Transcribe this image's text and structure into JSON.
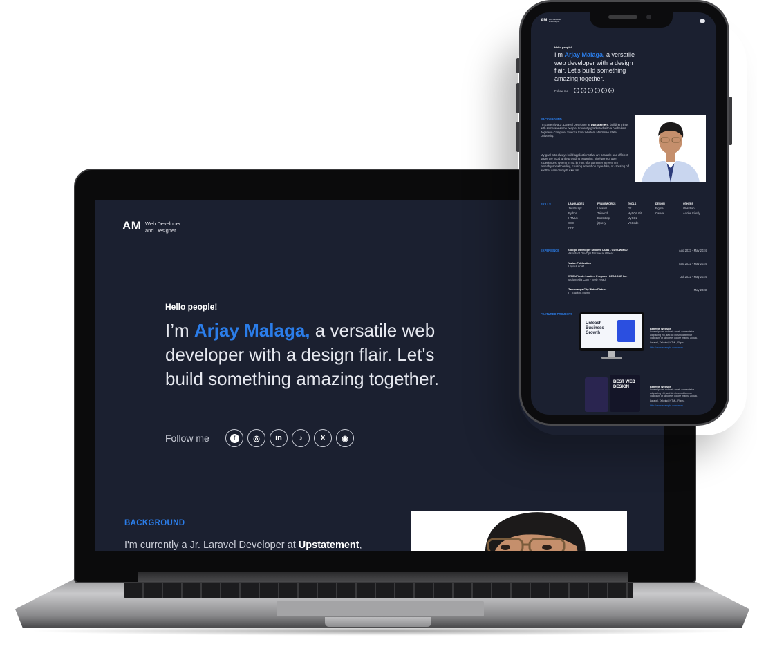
{
  "logo": {
    "initials": "AM",
    "tagline": "Web Developer and Designer"
  },
  "hero": {
    "greeting": "Hello people!",
    "prefix": "I’m ",
    "name": "Arjay Malaga",
    "comma": ",",
    "suffix": " a versatile web developer with a design flair. Let's build something amazing together."
  },
  "social": {
    "label": "Follow me",
    "icons": [
      "facebook-icon",
      "instagram-icon",
      "linkedin-icon",
      "tiktok-icon",
      "x-icon",
      "github-icon"
    ],
    "glyphs": [
      "f",
      "◎",
      "in",
      "♪",
      "X",
      "◉"
    ]
  },
  "background": {
    "heading": "BACKGROUND",
    "intro_prefix": "I'm currently a Jr. Laravel Developer at ",
    "company": "Upstatement",
    "intro_suffix": ",",
    "paragraph1": "building things with some awesome people. I recently graduated with a bachelor's degree in Computer Science from Western Mindanao State University.",
    "paragraph2": "My goal is to always build applications that are scalable and efficient under the hood while providing engaging, pixel-perfect user experiences. When I'm not in front of a computer screen, I'm probably snowboarding, cruising around on my e-bike, or crossing off another item on my bucket list."
  },
  "skills": {
    "heading": "SKILLS",
    "columns": [
      {
        "title": "LANGUAGES",
        "items": [
          "JavaScript",
          "Python",
          "HTML5",
          "CSS",
          "PHP"
        ]
      },
      {
        "title": "FRAMEWORKS",
        "items": [
          "Laravel",
          "Tailwind",
          "Bootstrap",
          "jQuery"
        ]
      },
      {
        "title": "TOOLS",
        "items": [
          "Git",
          "MySQL Git",
          "MySQL",
          "VSCode"
        ]
      },
      {
        "title": "DESIGN",
        "items": [
          "Figma",
          "Canva"
        ]
      },
      {
        "title": "OTHERS",
        "items": [
          "Obsidian",
          "Adobe Firefly"
        ]
      }
    ]
  },
  "experience": {
    "heading": "EXPERIENCE",
    "items": [
      {
        "title": "Google Developer Student Clubs - GDSCWMSU",
        "role": "Assistant DevOps Technical Officer",
        "date": "Aug 2023 - May 2024"
      },
      {
        "title": "Varian Publication",
        "role": "Layout Artist",
        "date": "Aug 2022 - May 2024"
      },
      {
        "title": "WMSU Youth Leaders Program - LEADCOE Inc.",
        "role": "Multimedia Cam - Web Head",
        "date": "Jul 2022 - May 2024"
      },
      {
        "title": "Zamboanga City Water District",
        "role": "IT Student Intern",
        "date": "May 2023"
      }
    ]
  },
  "projects": {
    "heading": "FEATURED PROJECTS",
    "items": [
      {
        "title": "Benefits Website",
        "description": "Lorem ipsum dolor sit amet, consectetur adipiscing elit, sed do eiusmod tempor incididunt ut labore et dolore magna aliqua.",
        "stack": "Laravel, Tailwind, HTML, Figma",
        "link": "http://www.example.com/arjay",
        "mock_headline": "Unleash Business Growth"
      },
      {
        "title": "Benefits Website",
        "description": "Lorem ipsum dolor sit amet, consectetur adipiscing elit, sed do eiusmod tempor incididunt ut labore et dolore magna aliqua.",
        "stack": "Laravel, Tailwind, HTML, Figma",
        "link": "http://www.example.com/arjay",
        "mock_headline": "BEST WEB DESIGN"
      }
    ]
  },
  "colors": {
    "accent": "#2b7de9",
    "background": "#1b2030",
    "text": "#e6e8ef"
  }
}
